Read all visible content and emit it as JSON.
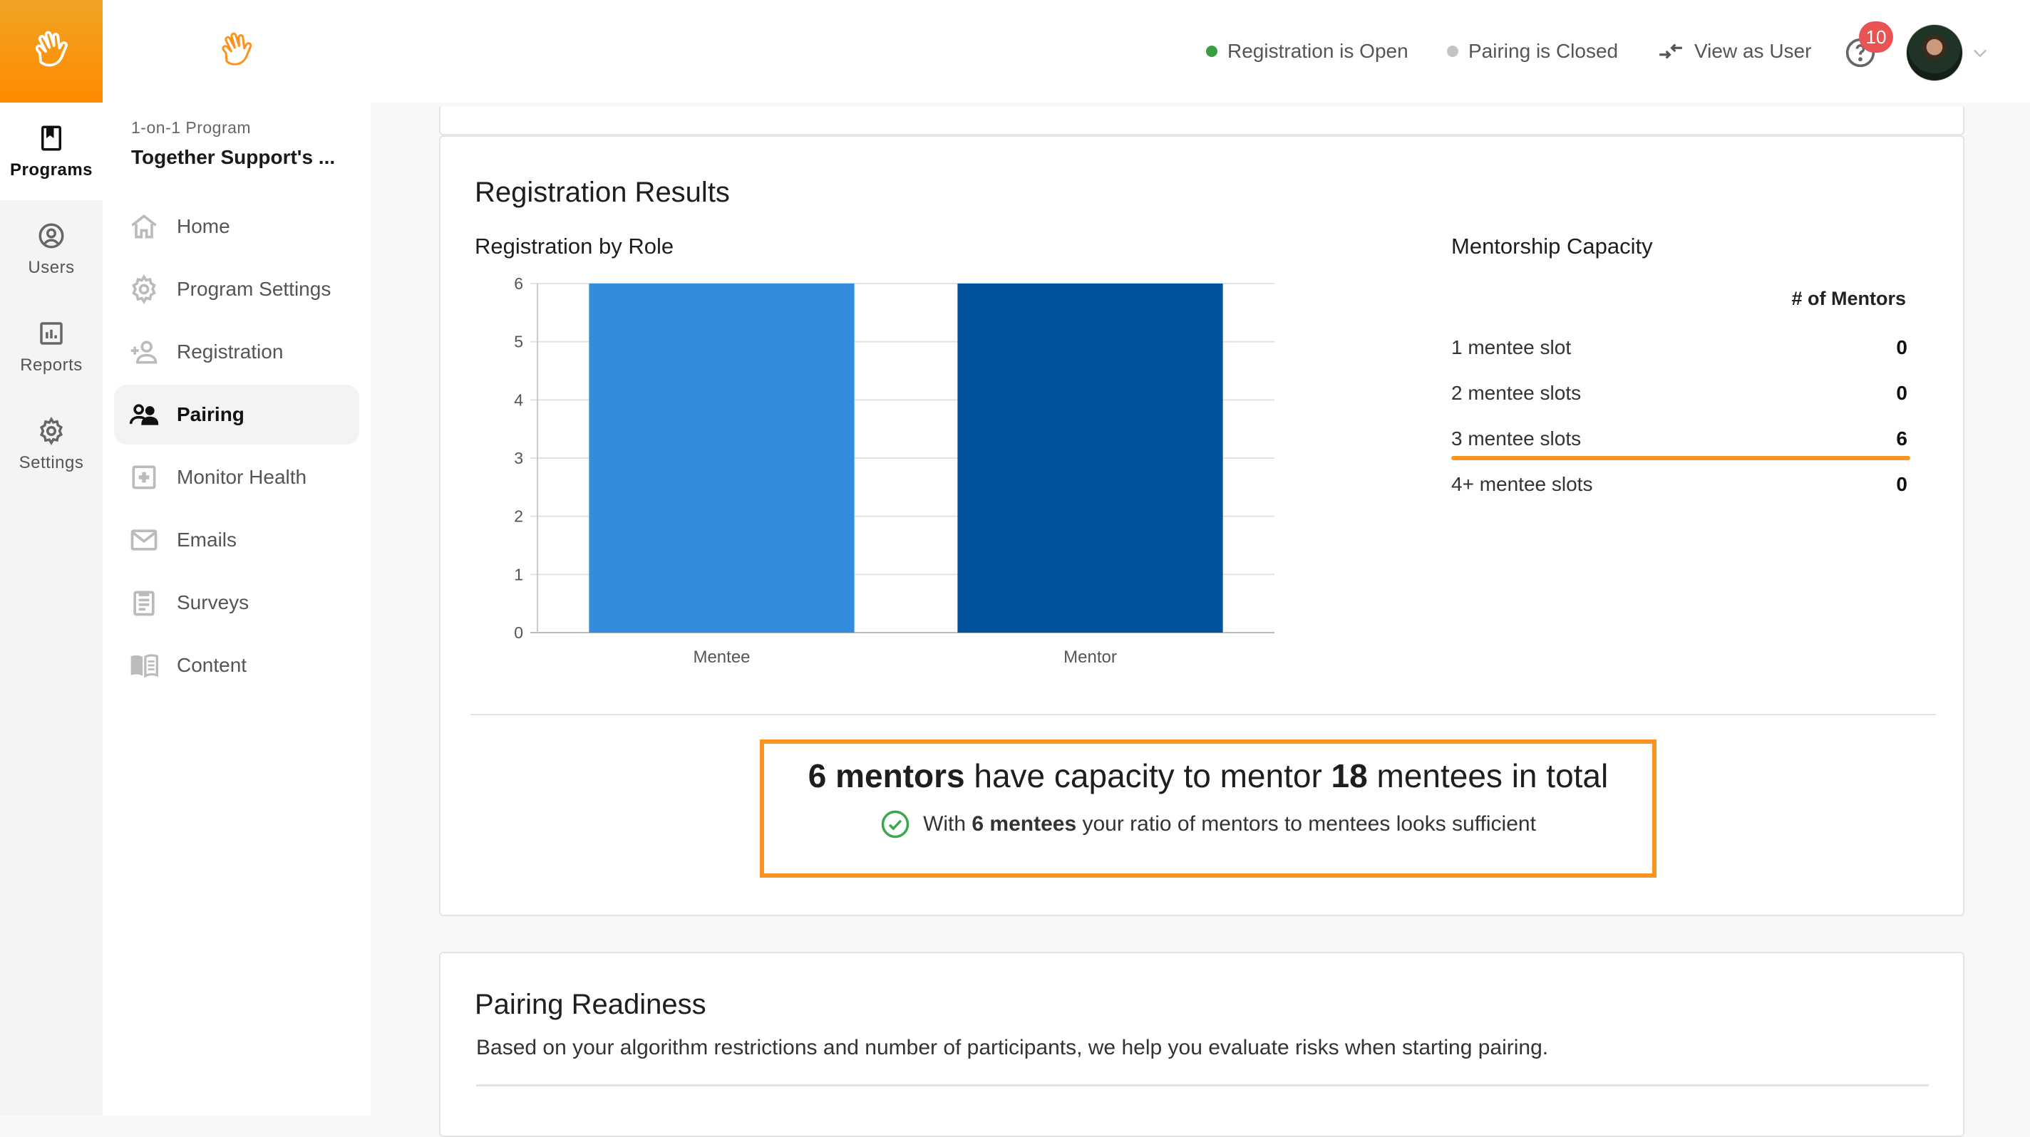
{
  "rail": {
    "items": [
      {
        "label": "Programs",
        "icon": "bookmark-book-icon",
        "active": true
      },
      {
        "label": "Users",
        "icon": "user-circle-icon"
      },
      {
        "label": "Reports",
        "icon": "bar-chart-icon"
      },
      {
        "label": "Settings",
        "icon": "gear-icon"
      }
    ]
  },
  "sidebar": {
    "program_type": "1-on-1 Program",
    "program_name": "Together Support's ...",
    "items": [
      {
        "label": "Home",
        "icon": "home-icon"
      },
      {
        "label": "Program Settings",
        "icon": "gear-icon"
      },
      {
        "label": "Registration",
        "icon": "add-user-icon"
      },
      {
        "label": "Pairing",
        "icon": "people-icon",
        "active": true
      },
      {
        "label": "Monitor Health",
        "icon": "medical-plus-icon"
      },
      {
        "label": "Emails",
        "icon": "mail-icon"
      },
      {
        "label": "Surveys",
        "icon": "clipboard-icon"
      },
      {
        "label": "Content",
        "icon": "open-book-icon"
      }
    ]
  },
  "topbar": {
    "registration_status": "Registration is Open",
    "registration_color": "#3a9d3f",
    "pairing_status": "Pairing is Closed",
    "pairing_color": "#c4c4c4",
    "view_as_user": "View as User",
    "help_badge": "10"
  },
  "registration_results": {
    "title": "Registration Results",
    "chart_title": "Registration by Role",
    "capacity": {
      "title": "Mentorship Capacity",
      "column_header": "# of Mentors",
      "rows": [
        {
          "label": "1 mentee slot",
          "value": "0"
        },
        {
          "label": "2 mentee slots",
          "value": "0"
        },
        {
          "label": "3 mentee slots",
          "value": "6",
          "highlighted": true
        },
        {
          "label": "4+ mentee slots",
          "value": "0"
        }
      ]
    },
    "summary": {
      "mentors_bold": "6 mentors",
      "middle": " have capacity to mentor ",
      "mentees_total_bold": "18",
      "end": " mentees in total",
      "sub_prefix": "With ",
      "sub_bold": "6 mentees",
      "sub_suffix": " your ratio of mentors to mentees looks sufficient"
    }
  },
  "chart_data": {
    "type": "bar",
    "title": "Registration by Role",
    "categories": [
      "Mentee",
      "Mentor"
    ],
    "values": [
      6,
      6
    ],
    "colors": [
      "#348ddc",
      "#02539b"
    ],
    "xlabel": "",
    "ylabel": "",
    "ylim": [
      0,
      6
    ],
    "yticks": [
      0,
      1,
      2,
      3,
      4,
      5,
      6
    ],
    "grid": true
  },
  "pairing_readiness": {
    "title": "Pairing Readiness",
    "description": "Based on your algorithm restrictions and number of participants, we help you evaluate risks when starting pairing."
  }
}
